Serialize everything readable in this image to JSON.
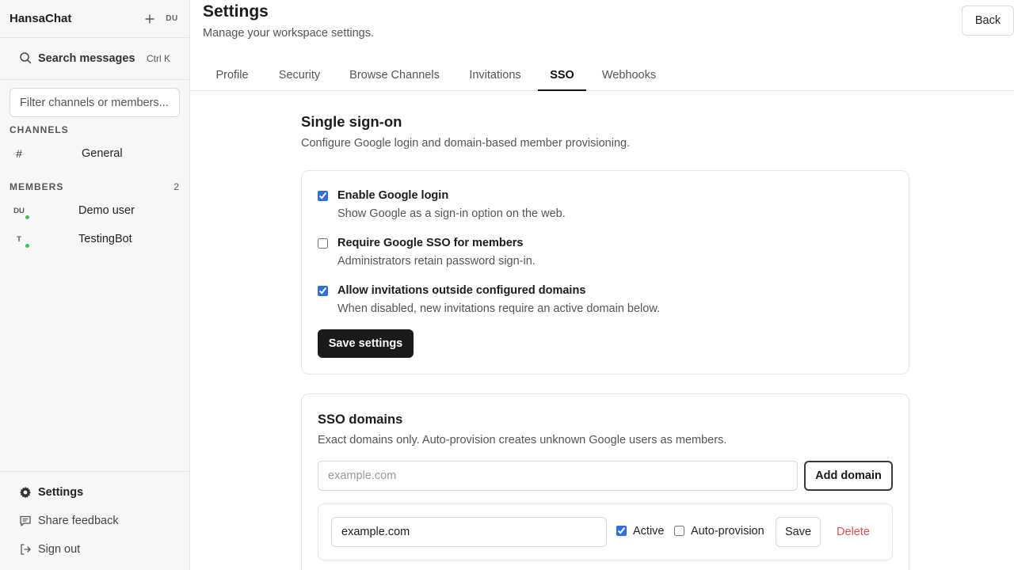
{
  "app": {
    "name": "HansaChat",
    "user_initials": "DU"
  },
  "sidebar": {
    "search_label": "Search messages",
    "search_shortcut": "Ctrl K",
    "filter_placeholder": "Filter channels or members...",
    "channels_heading": "CHANNELS",
    "channels": [
      {
        "name": "General"
      }
    ],
    "members_heading": "MEMBERS",
    "members_count": "2",
    "members": [
      {
        "initials": "DU",
        "name": "Demo user",
        "online": true
      },
      {
        "initials": "T",
        "name": "TestingBot",
        "online": true
      }
    ],
    "bottom": {
      "settings": "Settings",
      "feedback": "Share feedback",
      "signout": "Sign out"
    }
  },
  "header": {
    "title": "Settings",
    "subtitle": "Manage your workspace settings.",
    "back_label": "Back"
  },
  "tabs": [
    {
      "label": "Profile",
      "active": false
    },
    {
      "label": "Security",
      "active": false
    },
    {
      "label": "Browse Channels",
      "active": false
    },
    {
      "label": "Invitations",
      "active": false
    },
    {
      "label": "SSO",
      "active": true
    },
    {
      "label": "Webhooks",
      "active": false
    }
  ],
  "sso": {
    "title": "Single sign-on",
    "subtitle": "Configure Google login and domain-based member provisioning.",
    "options": [
      {
        "label": "Enable Google login",
        "description": "Show Google as a sign-in option on the web.",
        "checked": true
      },
      {
        "label": "Require Google SSO for members",
        "description": "Administrators retain password sign-in.",
        "checked": false
      },
      {
        "label": "Allow invitations outside configured domains",
        "description": "When disabled, new invitations require an active domain below.",
        "checked": true
      }
    ],
    "save_label": "Save settings"
  },
  "domains": {
    "title": "SSO domains",
    "subtitle": "Exact domains only. Auto-provision creates unknown Google users as members.",
    "input_placeholder": "example.com",
    "add_label": "Add domain",
    "rows": [
      {
        "domain": "example.com",
        "active_label": "Active",
        "active": true,
        "autoprov_label": "Auto-provision",
        "autoprov": false,
        "save_label": "Save",
        "delete_label": "Delete"
      }
    ]
  },
  "colors": {
    "accent": "#2f6fe0",
    "online": "#3cc35a",
    "danger": "#d9534f",
    "primary_button": "#1a1a1a"
  }
}
